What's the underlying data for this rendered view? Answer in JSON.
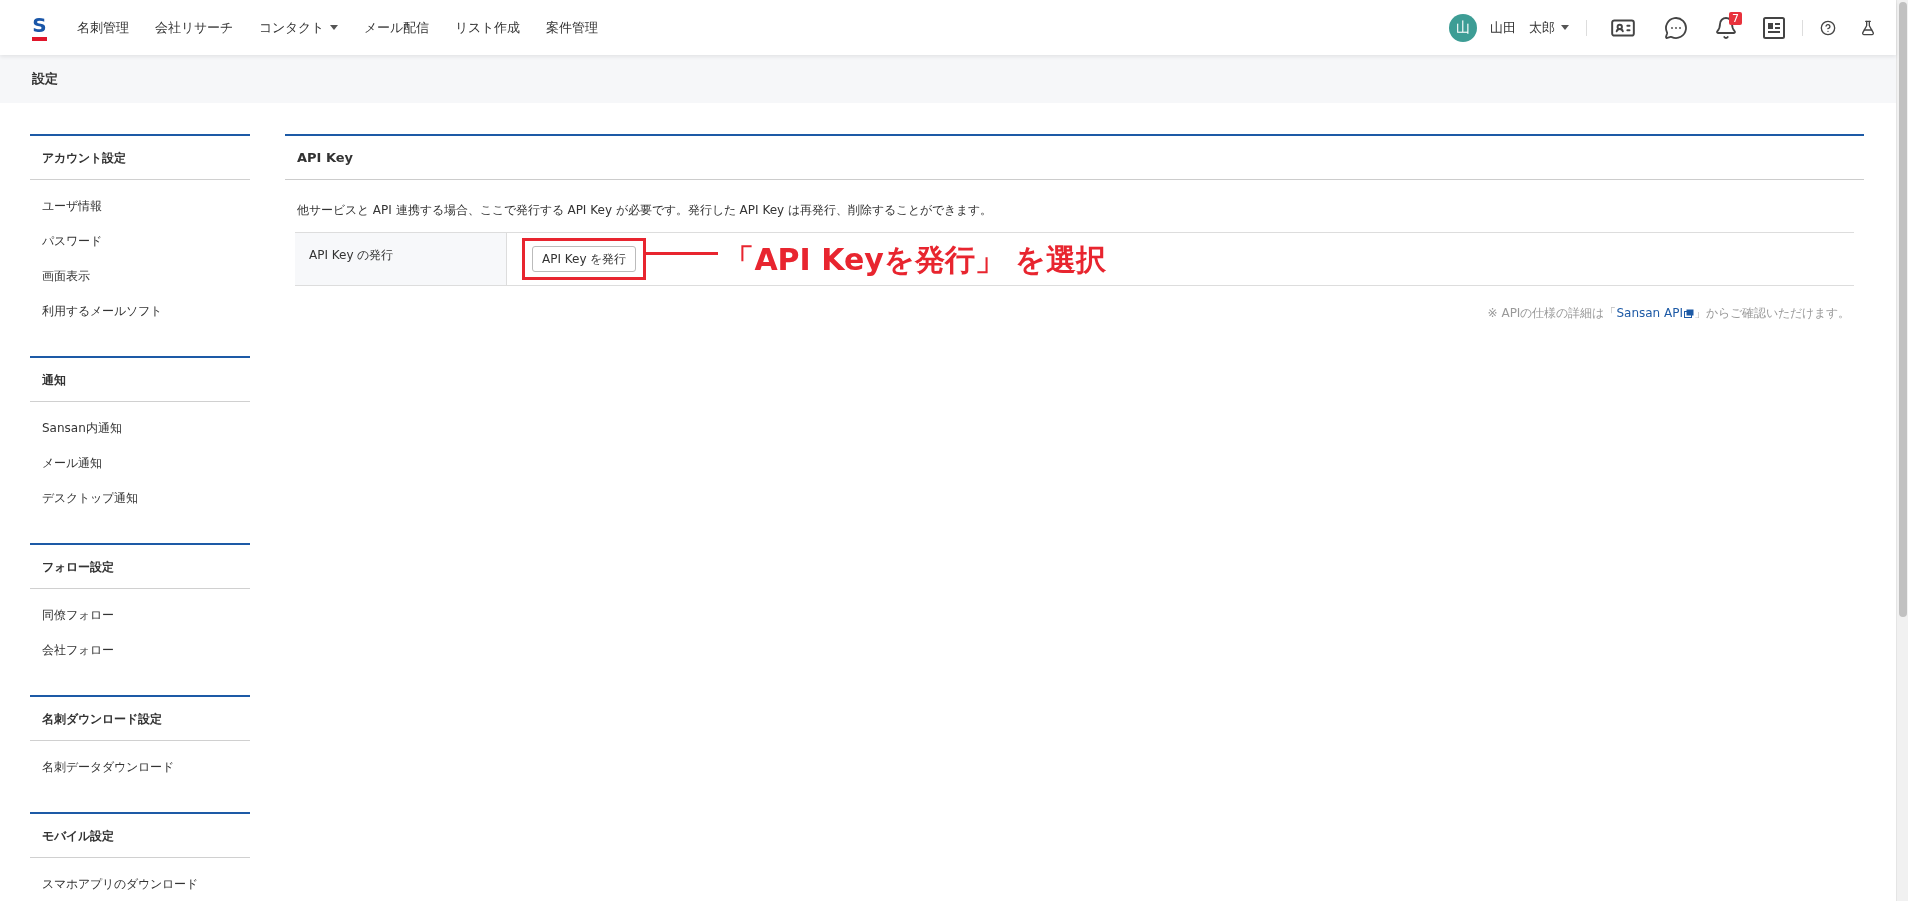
{
  "header": {
    "logo": "S",
    "nav": [
      {
        "label": "名刺管理",
        "kind": "link"
      },
      {
        "label": "会社リサーチ",
        "kind": "link"
      },
      {
        "label": "コンタクト",
        "kind": "dropdown"
      },
      {
        "label": "メール配信",
        "kind": "link"
      },
      {
        "label": "リスト作成",
        "kind": "link"
      },
      {
        "label": "案件管理",
        "kind": "link"
      }
    ],
    "user": {
      "avatar": "山",
      "name": "山田　太郎"
    },
    "notification_count": "7"
  },
  "page_title": "設定",
  "sidebar": [
    {
      "heading": "アカウント設定",
      "items": [
        "ユーザ情報",
        "パスワード",
        "画面表示",
        "利用するメールソフト"
      ]
    },
    {
      "heading": "通知",
      "items": [
        "Sansan内通知",
        "メール通知",
        "デスクトップ通知"
      ]
    },
    {
      "heading": "フォロー設定",
      "items": [
        "同僚フォロー",
        "会社フォロー"
      ]
    },
    {
      "heading": "名刺ダウンロード設定",
      "items": [
        "名刺データダウンロード"
      ]
    },
    {
      "heading": "モバイル設定",
      "items": [
        "スマホアプリのダウンロード"
      ]
    }
  ],
  "panel": {
    "title": "API Key",
    "description": "他サービスと API 連携する場合、ここで発行する API Key が必要です。発行した API Key は再発行、削除することができます。",
    "row": {
      "label": "API Key の発行",
      "button": "API Key を発行"
    },
    "annotation": "「API Keyを発行」 を選択",
    "note": {
      "prefix": "※ APIの仕様の詳細は「",
      "link": "Sansan API",
      "suffix": "」からご確認いただけます。"
    }
  }
}
